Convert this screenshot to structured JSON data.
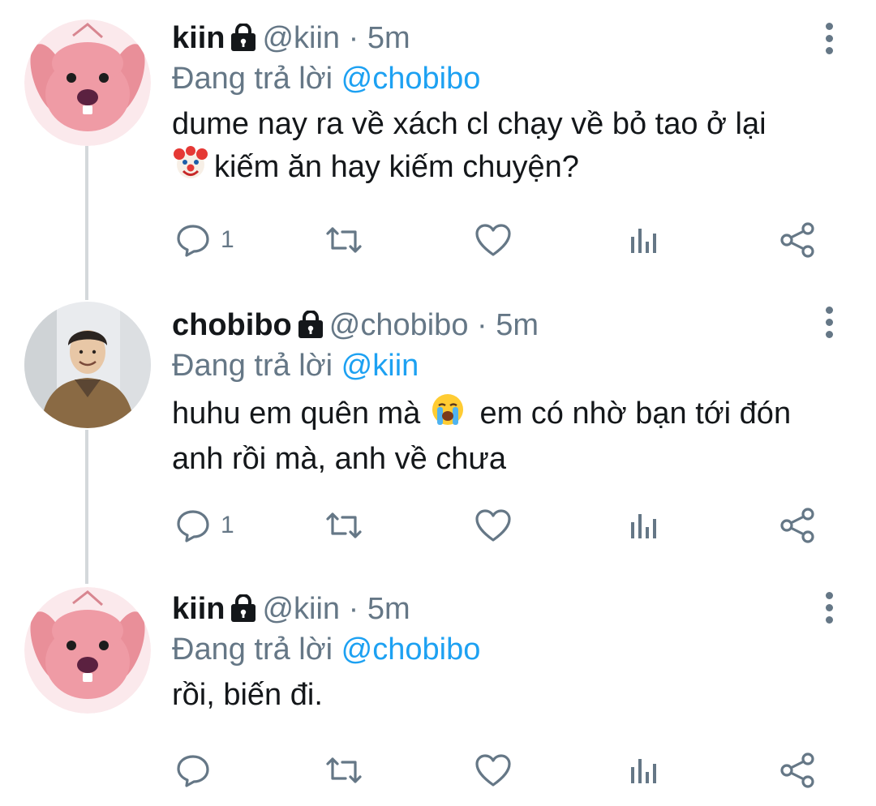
{
  "tweets": [
    {
      "name": "kiin",
      "handle": "@kiin",
      "separator": "·",
      "time": "5m",
      "replying_prefix": "Đang trả lời",
      "replying_to": "@chobibo",
      "text_line_1": "dume nay ra về xách cl chạy về bỏ tao ở lại",
      "text_line_2": "kiếm ăn hay kiếm chuyện?",
      "emoji": "clown-face-emoji",
      "reply_count": "1",
      "avatar": "pink-beaver-avatar"
    },
    {
      "name": "chobibo",
      "handle": "@chobibo",
      "separator": "·",
      "time": "5m",
      "replying_prefix": "Đang trả lời",
      "replying_to": "@kiin",
      "text_line_1_a": "huhu em quên mà",
      "text_line_1_b": "em có nhờ bạn tới đón",
      "text_line_2": "anh rồi mà, anh về chưa",
      "emoji": "loudly-crying-face-emoji",
      "reply_count": "1",
      "avatar": "person-photo-avatar"
    },
    {
      "name": "kiin",
      "handle": "@kiin",
      "separator": "·",
      "time": "5m",
      "replying_prefix": "Đang trả lời",
      "replying_to": "@chobibo",
      "text_line_1": "rồi, biến đi.",
      "reply_count": "",
      "avatar": "pink-beaver-avatar"
    }
  ],
  "colors": {
    "text": "#14171a",
    "secondary": "#657786",
    "link": "#1da1f2",
    "thread_line": "#d4d8db"
  },
  "icons": [
    "reply-icon",
    "retweet-icon",
    "like-icon",
    "analytics-icon",
    "share-icon",
    "lock-icon",
    "more-icon"
  ]
}
